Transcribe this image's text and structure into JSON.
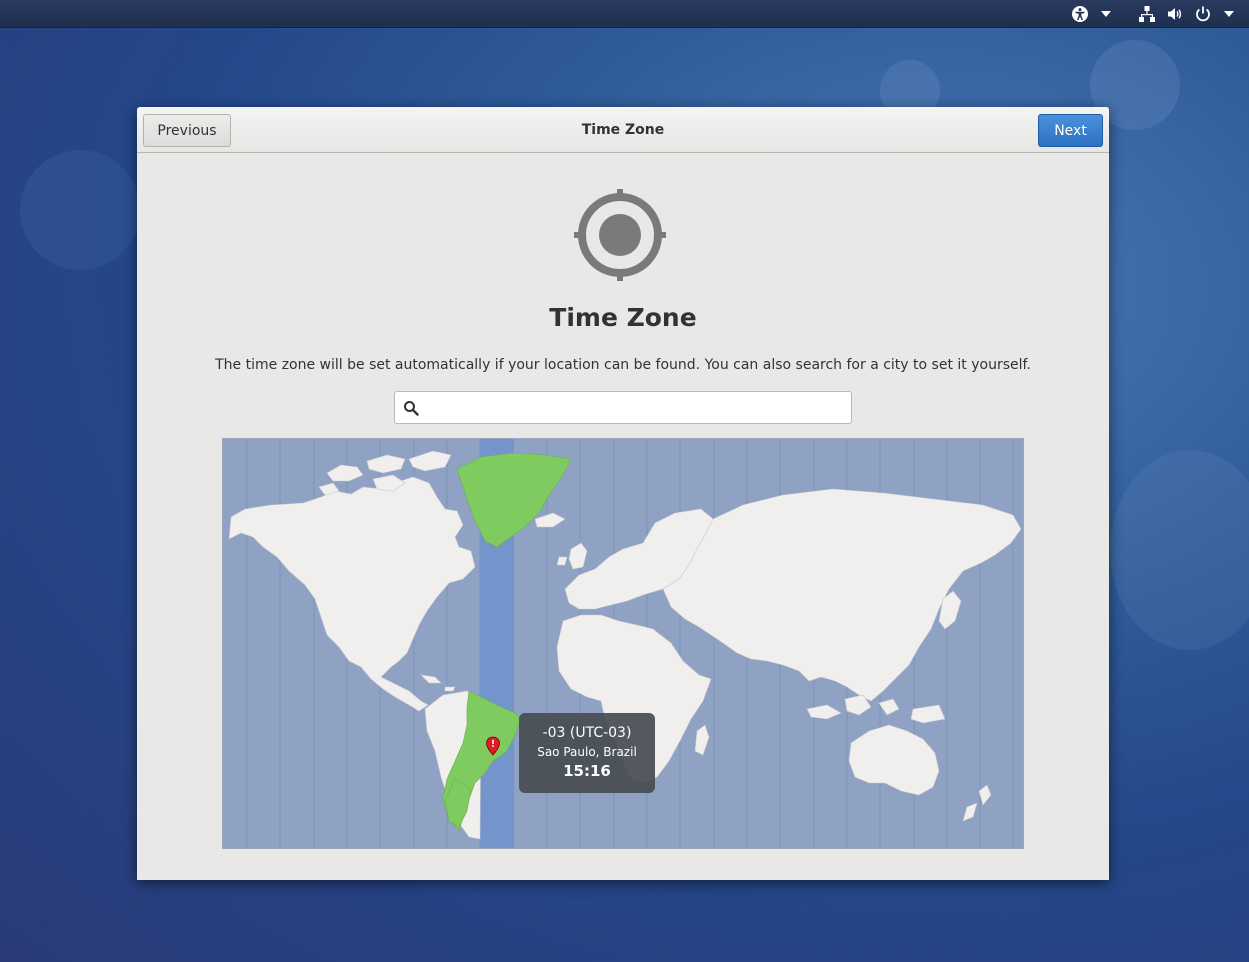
{
  "window": {
    "title": "Time Zone",
    "previous_label": "Previous",
    "next_label": "Next"
  },
  "page": {
    "heading": "Time Zone",
    "description": "The time zone will be set automatically if your location can be found. You can also search for a city to set it yourself.",
    "search": {
      "value": "",
      "placeholder": ""
    }
  },
  "map": {
    "selected": {
      "zone": "-03 (UTC-03)",
      "city": "Sao Paulo, Brazil",
      "time": "15:16"
    }
  },
  "topbar": {
    "icons": [
      "accessibility-icon",
      "chevron-down-icon",
      "network-icon",
      "volume-icon",
      "power-icon",
      "chevron-down-icon"
    ]
  },
  "colors": {
    "accent": "#3584e4",
    "map_ocean": "#8fa2c3",
    "map_land": "#f1efee",
    "selected_zone_land": "#7fcb5f",
    "selected_zone_band": "#7395cc",
    "tooltip_bg": "#484c52"
  }
}
